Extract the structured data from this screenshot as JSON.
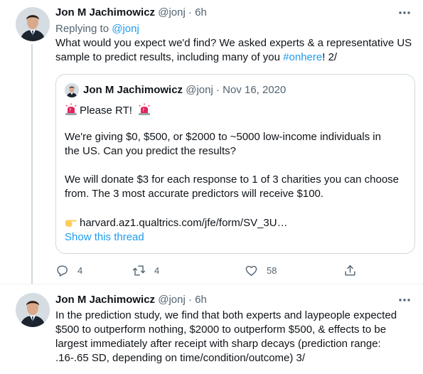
{
  "tweet1": {
    "author_name": "Jon M Jachimowicz",
    "handle": "@jonj",
    "dot": "·",
    "time": "6h",
    "replying_prefix": "Replying to",
    "replying_handle": "@jonj",
    "text_line1": "What would you expect we'd find? We asked experts & a representative US",
    "text_line2_prefix": "sample to predict results, including many of you",
    "hashtag": "#onhere",
    "text_line2_suffix": "! 2/",
    "quote": {
      "author_name": "Jon M Jachimowicz",
      "handle": "@jonj",
      "dot": "·",
      "date": "Nov 16, 2020",
      "line1": "Please RT!",
      "line2": "We're giving $0, $500, or $2000 to ~5000 low-income individuals in",
      "line3": "the US. Can you predict the results?",
      "line4": "We will donate $3 for each response to 1 of 3 charities you can choose",
      "line5": "from. The 3 most accurate predictors will receive $100.",
      "link": "harvard.az1.qualtrics.com/jfe/form/SV_3U…",
      "show_thread": "Show this thread"
    },
    "actions": {
      "reply_count": "4",
      "retweet_count": "4",
      "like_count": "58"
    }
  },
  "tweet2": {
    "author_name": "Jon M Jachimowicz",
    "handle": "@jonj",
    "dot": "·",
    "time": "6h",
    "line1": "In the prediction study, we find that both experts and laypeople expected",
    "line2": "$500 to outperform nothing, $2000 to outperform $500, & effects to be",
    "line3": "largest immediately after receipt with sharp decays (prediction range:",
    "line4": ".16-.65 SD, depending on time/condition/outcome) 3/"
  },
  "colors": {
    "accent": "#1d9bf0",
    "secondary_text": "#536471",
    "border": "#cfd9de",
    "siren_red": "#e0245e"
  }
}
